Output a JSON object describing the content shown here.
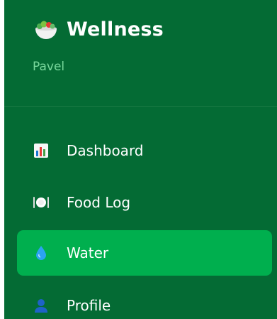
{
  "brand": {
    "title": "Wellness",
    "icon": "salad-bowl-icon"
  },
  "user": {
    "name": "Pavel"
  },
  "nav": {
    "items": [
      {
        "label": "Dashboard",
        "icon": "bar-chart-icon",
        "active": false
      },
      {
        "label": "Food Log",
        "icon": "fork-plate-knife-icon",
        "active": false
      },
      {
        "label": "Water",
        "icon": "water-drop-icon",
        "active": true
      },
      {
        "label": "Profile",
        "icon": "user-icon",
        "active": false
      }
    ]
  },
  "colors": {
    "sidebar_bg": "#046b34",
    "active_bg": "#00af4e",
    "user_name": "#79d89c",
    "text": "#ffffff"
  }
}
